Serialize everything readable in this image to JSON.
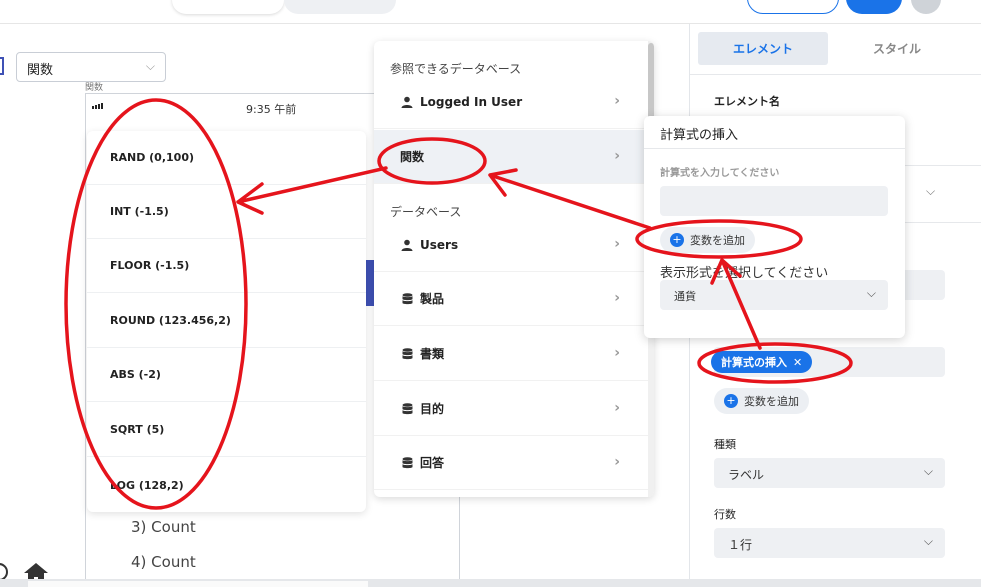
{
  "function_select": {
    "value": "関数"
  },
  "canvas": {
    "small_label": "関数",
    "phone_time": "9:35 午前",
    "count_items": [
      "3) Count",
      "4) Count"
    ]
  },
  "function_list": [
    "RAND (0,100)",
    "INT (-1.5)",
    "FLOOR (-1.5)",
    "ROUND (123.456,2)",
    "ABS (-2)",
    "SQRT (5)",
    "LOG (128,2)"
  ],
  "data_menu": {
    "header_ref": "参照できるデータベース",
    "logged_in": "Logged In User",
    "functions": "関数",
    "header_db": "データベース",
    "items": [
      "Users",
      "製品",
      "書類",
      "目的",
      "回答"
    ]
  },
  "right_panel": {
    "tab_element": "エレメント",
    "tab_style": "スタイル",
    "element_name_label": "エレメント名",
    "formula_chip": "計算式の挿入",
    "add_variable": "変数を追加",
    "type_label": "種類",
    "type_value": "ラベル",
    "rows_label": "行数",
    "rows_value": "１行"
  },
  "formula_popup": {
    "title": "計算式の挿入",
    "input_hint": "計算式を入力してください",
    "add_variable": "変数を追加",
    "format_label": "表示形式を選択してください",
    "format_value": "通貨"
  },
  "colors": {
    "accent": "#1a73e8",
    "annotation": "#e5141c",
    "sidebar_accent": "#3f51b5"
  }
}
